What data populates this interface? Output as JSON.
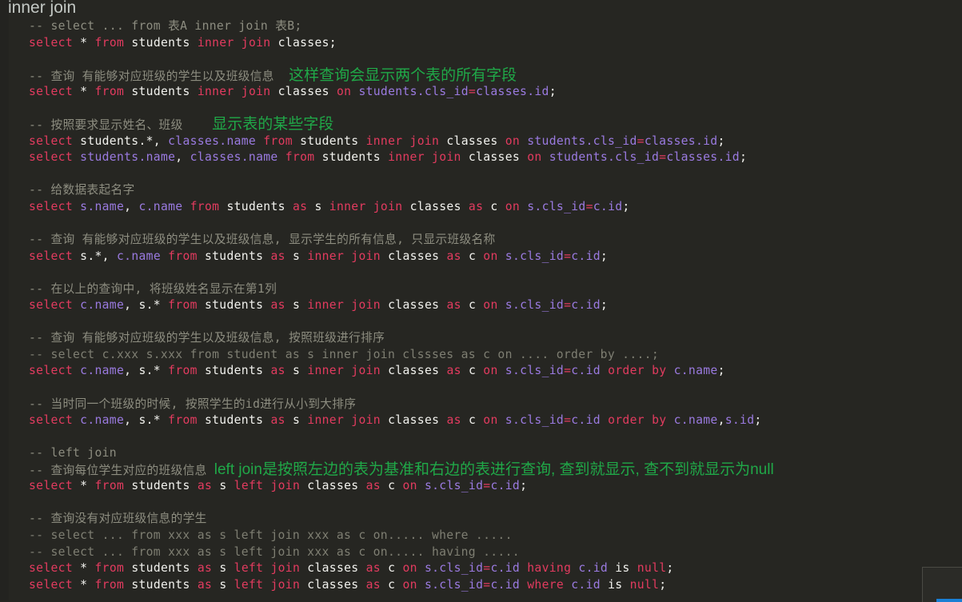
{
  "header": {
    "title": "inner join",
    "clipped_glyph": "¯"
  },
  "editor": {
    "background": "#262622",
    "colors": {
      "keyword": "#e23b5f",
      "identifier": "#f2f2ee",
      "column": "#9a7ae0",
      "comment": "#8d8d80",
      "annotation_green": "#20a848",
      "title_grey": "#c3c8c4"
    }
  },
  "lines": [
    {
      "n": 1,
      "type": "comment",
      "text": "-- select ... from 表A inner join 表B;"
    },
    {
      "n": 2,
      "type": "sql",
      "text": "select * from students inner join classes;"
    },
    {
      "n": 3,
      "type": "blank",
      "text": ""
    },
    {
      "n": 4,
      "type": "comment",
      "text": "-- 查询 有能够对应班级的学生以及班级信息",
      "note": "这样查询会显示两个表的所有字段"
    },
    {
      "n": 5,
      "type": "sql",
      "text": "select * from students inner join classes on students.cls_id=classes.id;"
    },
    {
      "n": 6,
      "type": "blank",
      "text": ""
    },
    {
      "n": 7,
      "type": "comment",
      "text": "-- 按照要求显示姓名、班级",
      "note": "显示表的某些字段"
    },
    {
      "n": 8,
      "type": "sql",
      "text": "select students.*, classes.name from students inner join classes on students.cls_id=classes.id;"
    },
    {
      "n": 9,
      "type": "sql",
      "text": "select students.name, classes.name from students inner join classes on students.cls_id=classes.id;"
    },
    {
      "n": 10,
      "type": "blank",
      "text": ""
    },
    {
      "n": 11,
      "type": "comment",
      "text": "-- 给数据表起名字"
    },
    {
      "n": 12,
      "type": "sql",
      "text": "select s.name, c.name from students as s inner join classes as c on s.cls_id=c.id;"
    },
    {
      "n": 13,
      "type": "blank",
      "text": ""
    },
    {
      "n": 14,
      "type": "comment",
      "text": "-- 查询 有能够对应班级的学生以及班级信息, 显示学生的所有信息, 只显示班级名称"
    },
    {
      "n": 15,
      "type": "sql",
      "text": "select s.*, c.name from students as s inner join classes as c on s.cls_id=c.id;"
    },
    {
      "n": 16,
      "type": "blank",
      "text": ""
    },
    {
      "n": 17,
      "type": "comment",
      "text": "-- 在以上的查询中, 将班级姓名显示在第1列"
    },
    {
      "n": 18,
      "type": "sql",
      "text": "select c.name, s.* from students as s inner join classes as c on s.cls_id=c.id;"
    },
    {
      "n": 19,
      "type": "blank",
      "text": ""
    },
    {
      "n": 20,
      "type": "comment",
      "text": "-- 查询 有能够对应班级的学生以及班级信息, 按照班级进行排序"
    },
    {
      "n": 21,
      "type": "comment-dim",
      "text": "-- select c.xxx s.xxx from student as s inner join clssses as c on .... order by ....;"
    },
    {
      "n": 22,
      "type": "sql",
      "text": "select c.name, s.* from students as s inner join classes as c on s.cls_id=c.id order by c.name;"
    },
    {
      "n": 23,
      "type": "blank",
      "text": ""
    },
    {
      "n": 24,
      "type": "comment",
      "text": "-- 当时同一个班级的时候, 按照学生的id进行从小到大排序"
    },
    {
      "n": 25,
      "type": "sql",
      "text": "select c.name, s.* from students as s inner join classes as c on s.cls_id=c.id order by c.name,s.id;"
    },
    {
      "n": 26,
      "type": "blank",
      "text": ""
    },
    {
      "n": 27,
      "type": "comment",
      "text": "-- left join"
    },
    {
      "n": 28,
      "type": "comment",
      "text": "-- 查询每位学生对应的班级信息",
      "note": "left join是按照左边的表为基准和右边的表进行查询, 查到就显示, 查不到就显示为null"
    },
    {
      "n": 29,
      "type": "sql",
      "text": "select * from students as s left join classes as c on s.cls_id=c.id;"
    },
    {
      "n": 30,
      "type": "blank",
      "text": ""
    },
    {
      "n": 31,
      "type": "comment",
      "text": "-- 查询没有对应班级信息的学生"
    },
    {
      "n": 32,
      "type": "comment-dim",
      "text": "-- select ... from xxx as s left join xxx as c on..... where ....."
    },
    {
      "n": 33,
      "type": "comment-dim",
      "text": "-- select ... from xxx as s left join xxx as c on..... having ....."
    },
    {
      "n": 34,
      "type": "sql",
      "text": "select * from students as s left join classes as c on s.cls_id=c.id having c.id is null;"
    },
    {
      "n": 35,
      "type": "sql",
      "text": "select * from students as s left join classes as c on s.cls_id=c.id where c.id is null;"
    }
  ],
  "annotations": [
    {
      "id": "note-all-fields",
      "text": "这样查询会显示两个表的所有字段",
      "color": "#20a848"
    },
    {
      "id": "note-some-fields",
      "text": "显示表的某些字段",
      "color": "#20a848"
    },
    {
      "id": "note-left-join",
      "text": "left join是按照左边的表为基准和右边的表进行查询, 查到就显示, 查不到就显示为null",
      "color": "#20a848"
    }
  ],
  "keywords": [
    "select",
    "from",
    "inner",
    "join",
    "as",
    "on",
    "order",
    "by",
    "left",
    "having",
    "where",
    "is",
    "null"
  ]
}
